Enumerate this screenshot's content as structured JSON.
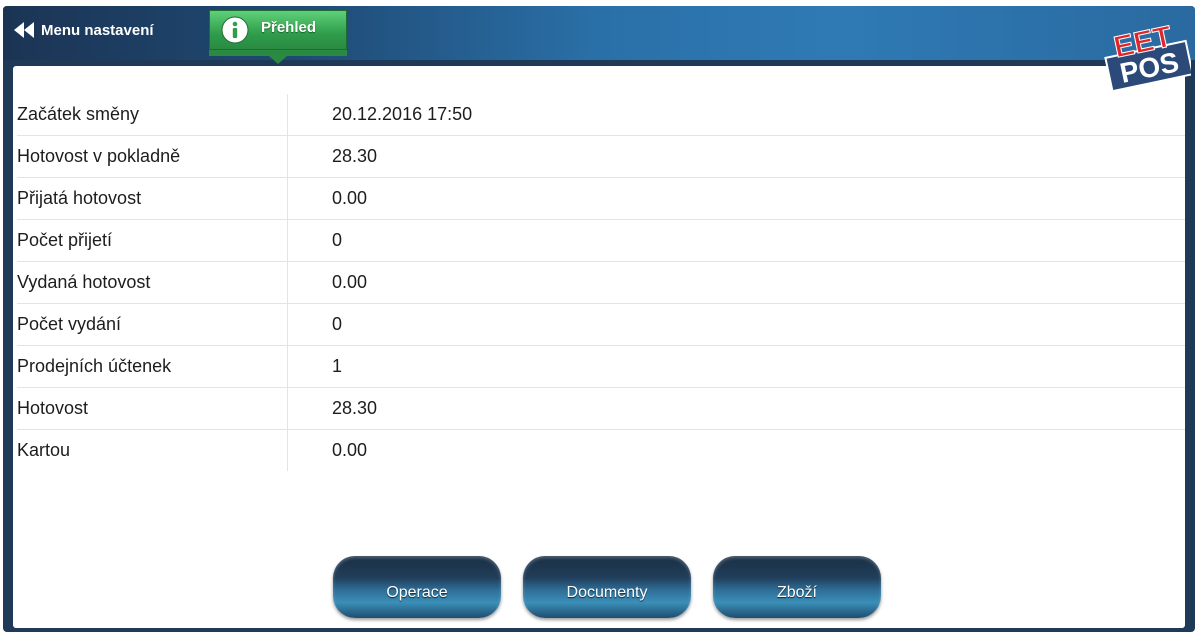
{
  "header": {
    "back_label": "Menu nastavení",
    "active_tab_label": "Přehled",
    "logo_top": "EET",
    "logo_bottom": "POS",
    "accent_green": "#2f9d4b",
    "bar_color": "#2a70a8"
  },
  "summary": {
    "rows": [
      {
        "label": "Začátek směny",
        "value": "20.12.2016 17:50"
      },
      {
        "label": "Hotovost v pokladně",
        "value": "28.30"
      },
      {
        "label": "Přijatá hotovost",
        "value": "0.00"
      },
      {
        "label": "Počet přijetí",
        "value": "0"
      },
      {
        "label": "Vydaná hotovost",
        "value": "0.00"
      },
      {
        "label": "Počet vydání",
        "value": "0"
      },
      {
        "label": "Prodejních účtenek",
        "value": "1"
      },
      {
        "label": "Hotovost",
        "value": "28.30"
      },
      {
        "label": "Kartou",
        "value": "0.00"
      }
    ]
  },
  "actions": {
    "operace_label": "Operace",
    "documenty_label": "Documenty",
    "zbozi_label": "Zboží"
  },
  "icons": {
    "back": "double-left-arrow-icon",
    "info": "info-icon"
  }
}
